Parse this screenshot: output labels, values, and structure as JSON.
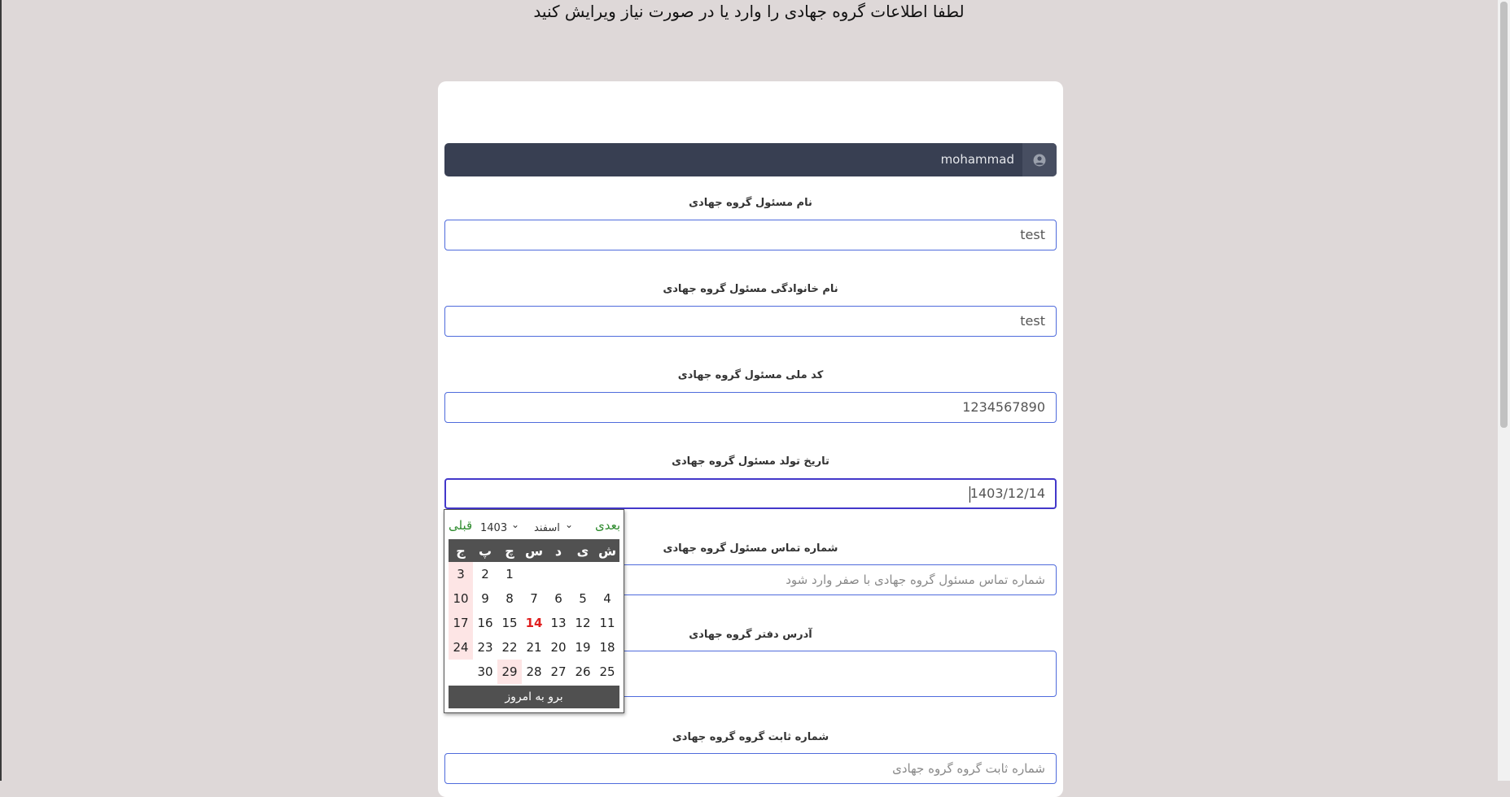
{
  "page": {
    "title": "لطفا اطلاعات گروه جهادی را وارد یا در صورت نیاز ویرایش کنید"
  },
  "user_bar": {
    "username": "mohammad",
    "icon": "user-circle-icon"
  },
  "fields": {
    "first_name": {
      "label": "نام مسئول گروه جهادی",
      "value": "test"
    },
    "last_name": {
      "label": "نام خانوادگی مسئول گروه جهادی",
      "value": "test"
    },
    "national_code": {
      "label": "کد ملی مسئول گروه جهادی",
      "value": "1234567890"
    },
    "birth_date": {
      "label": "تاریخ تولد مسئول گروه جهادی",
      "value": "1403/12/14"
    },
    "phone": {
      "label": "شماره تماس مسئول گروه جهادی",
      "placeholder": "شماره تماس مسئول گروه جهادی با صفر وارد شود"
    },
    "address": {
      "label": "آدرس دفتر گروه جهادی",
      "value": ""
    },
    "landline": {
      "label": "شماره ثابت گروه گروه جهادی",
      "placeholder": "شماره ثابت گروه گروه جهادی"
    }
  },
  "datepicker": {
    "next_label": "بعدی",
    "prev_label": "قبلی",
    "month_select": "اسفند",
    "year_select": "1403",
    "weekday_headers": [
      "ش",
      "ی",
      "د",
      "س",
      "چ",
      "پ",
      "ج"
    ],
    "weeks": [
      [
        "",
        "",
        "",
        "",
        "1",
        "2",
        "3"
      ],
      [
        "4",
        "5",
        "6",
        "7",
        "8",
        "9",
        "10"
      ],
      [
        "11",
        "12",
        "13",
        "14",
        "15",
        "16",
        "17"
      ],
      [
        "18",
        "19",
        "20",
        "21",
        "22",
        "23",
        "24"
      ],
      [
        "25",
        "26",
        "27",
        "28",
        "29",
        "30",
        ""
      ]
    ],
    "selected_day": "14",
    "holiday_days": [
      "29"
    ],
    "today_button": "برو به امروز"
  },
  "colors": {
    "background": "#ded8d8",
    "user_bar": "#383f52",
    "input_border": "#4f6bdc",
    "holiday": "#fde5e5",
    "nav_green": "#2e8b2e"
  }
}
